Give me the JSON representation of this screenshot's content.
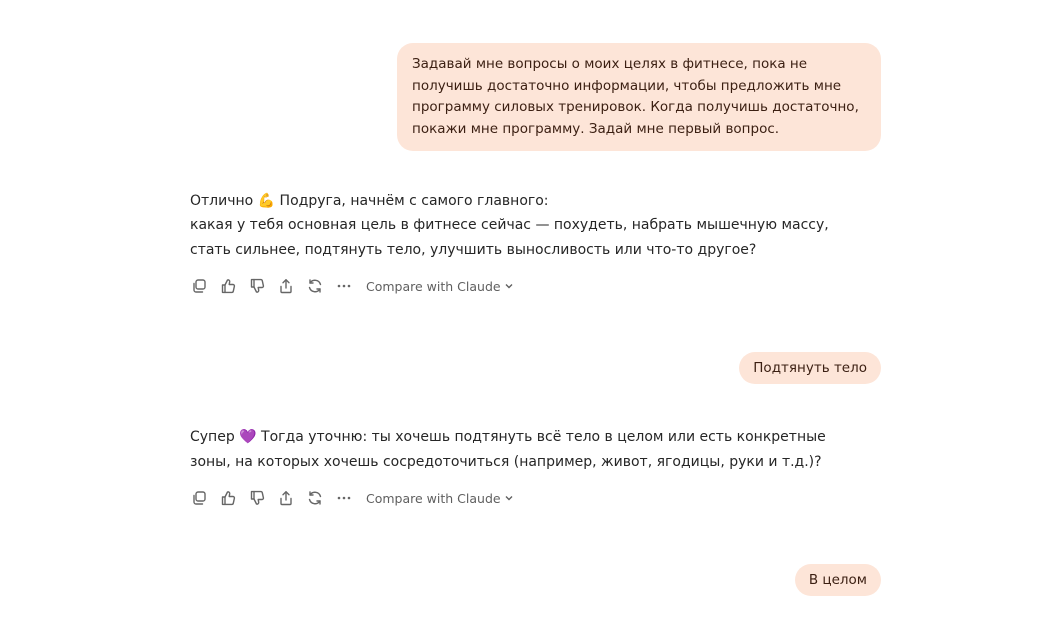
{
  "messages": {
    "user1": {
      "text": "Задавай мне вопросы о моих целях в фитнесе, пока не получишь достаточно информации, чтобы предложить мне программу силовых тренировок. Когда получишь достаточно, покажи мне программу. Задай мне первый вопрос."
    },
    "ai1": {
      "line1": "Отлично 💪 Подруга, начнём с самого главного:",
      "line2": "какая у тебя основная цель в фитнесе сейчас — похудеть, набрать мышечную массу, стать сильнее, подтянуть тело, улучшить выносливость или что-то другое?"
    },
    "user2": {
      "text": "Подтянуть тело"
    },
    "ai2": {
      "text": "Супер 💜 Тогда уточню: ты хочешь подтянуть всё тело в целом или есть конкретные зоны, на которых хочешь сосредоточиться (например, живот, ягодицы, руки и т.д.)?"
    },
    "user3": {
      "text": "В целом"
    }
  },
  "toolbar": {
    "compare_label": "Compare with Claude",
    "icons": [
      "copy-icon",
      "thumbs-up-icon",
      "thumbs-down-icon",
      "share-icon",
      "regenerate-icon",
      "more-icon",
      "chevron-down-icon"
    ]
  },
  "colors": {
    "user_bubble_bg": "#fde5d8",
    "user_bubble_text": "#3b1f12",
    "assistant_text": "#262626",
    "toolbar_icon": "#666666"
  }
}
